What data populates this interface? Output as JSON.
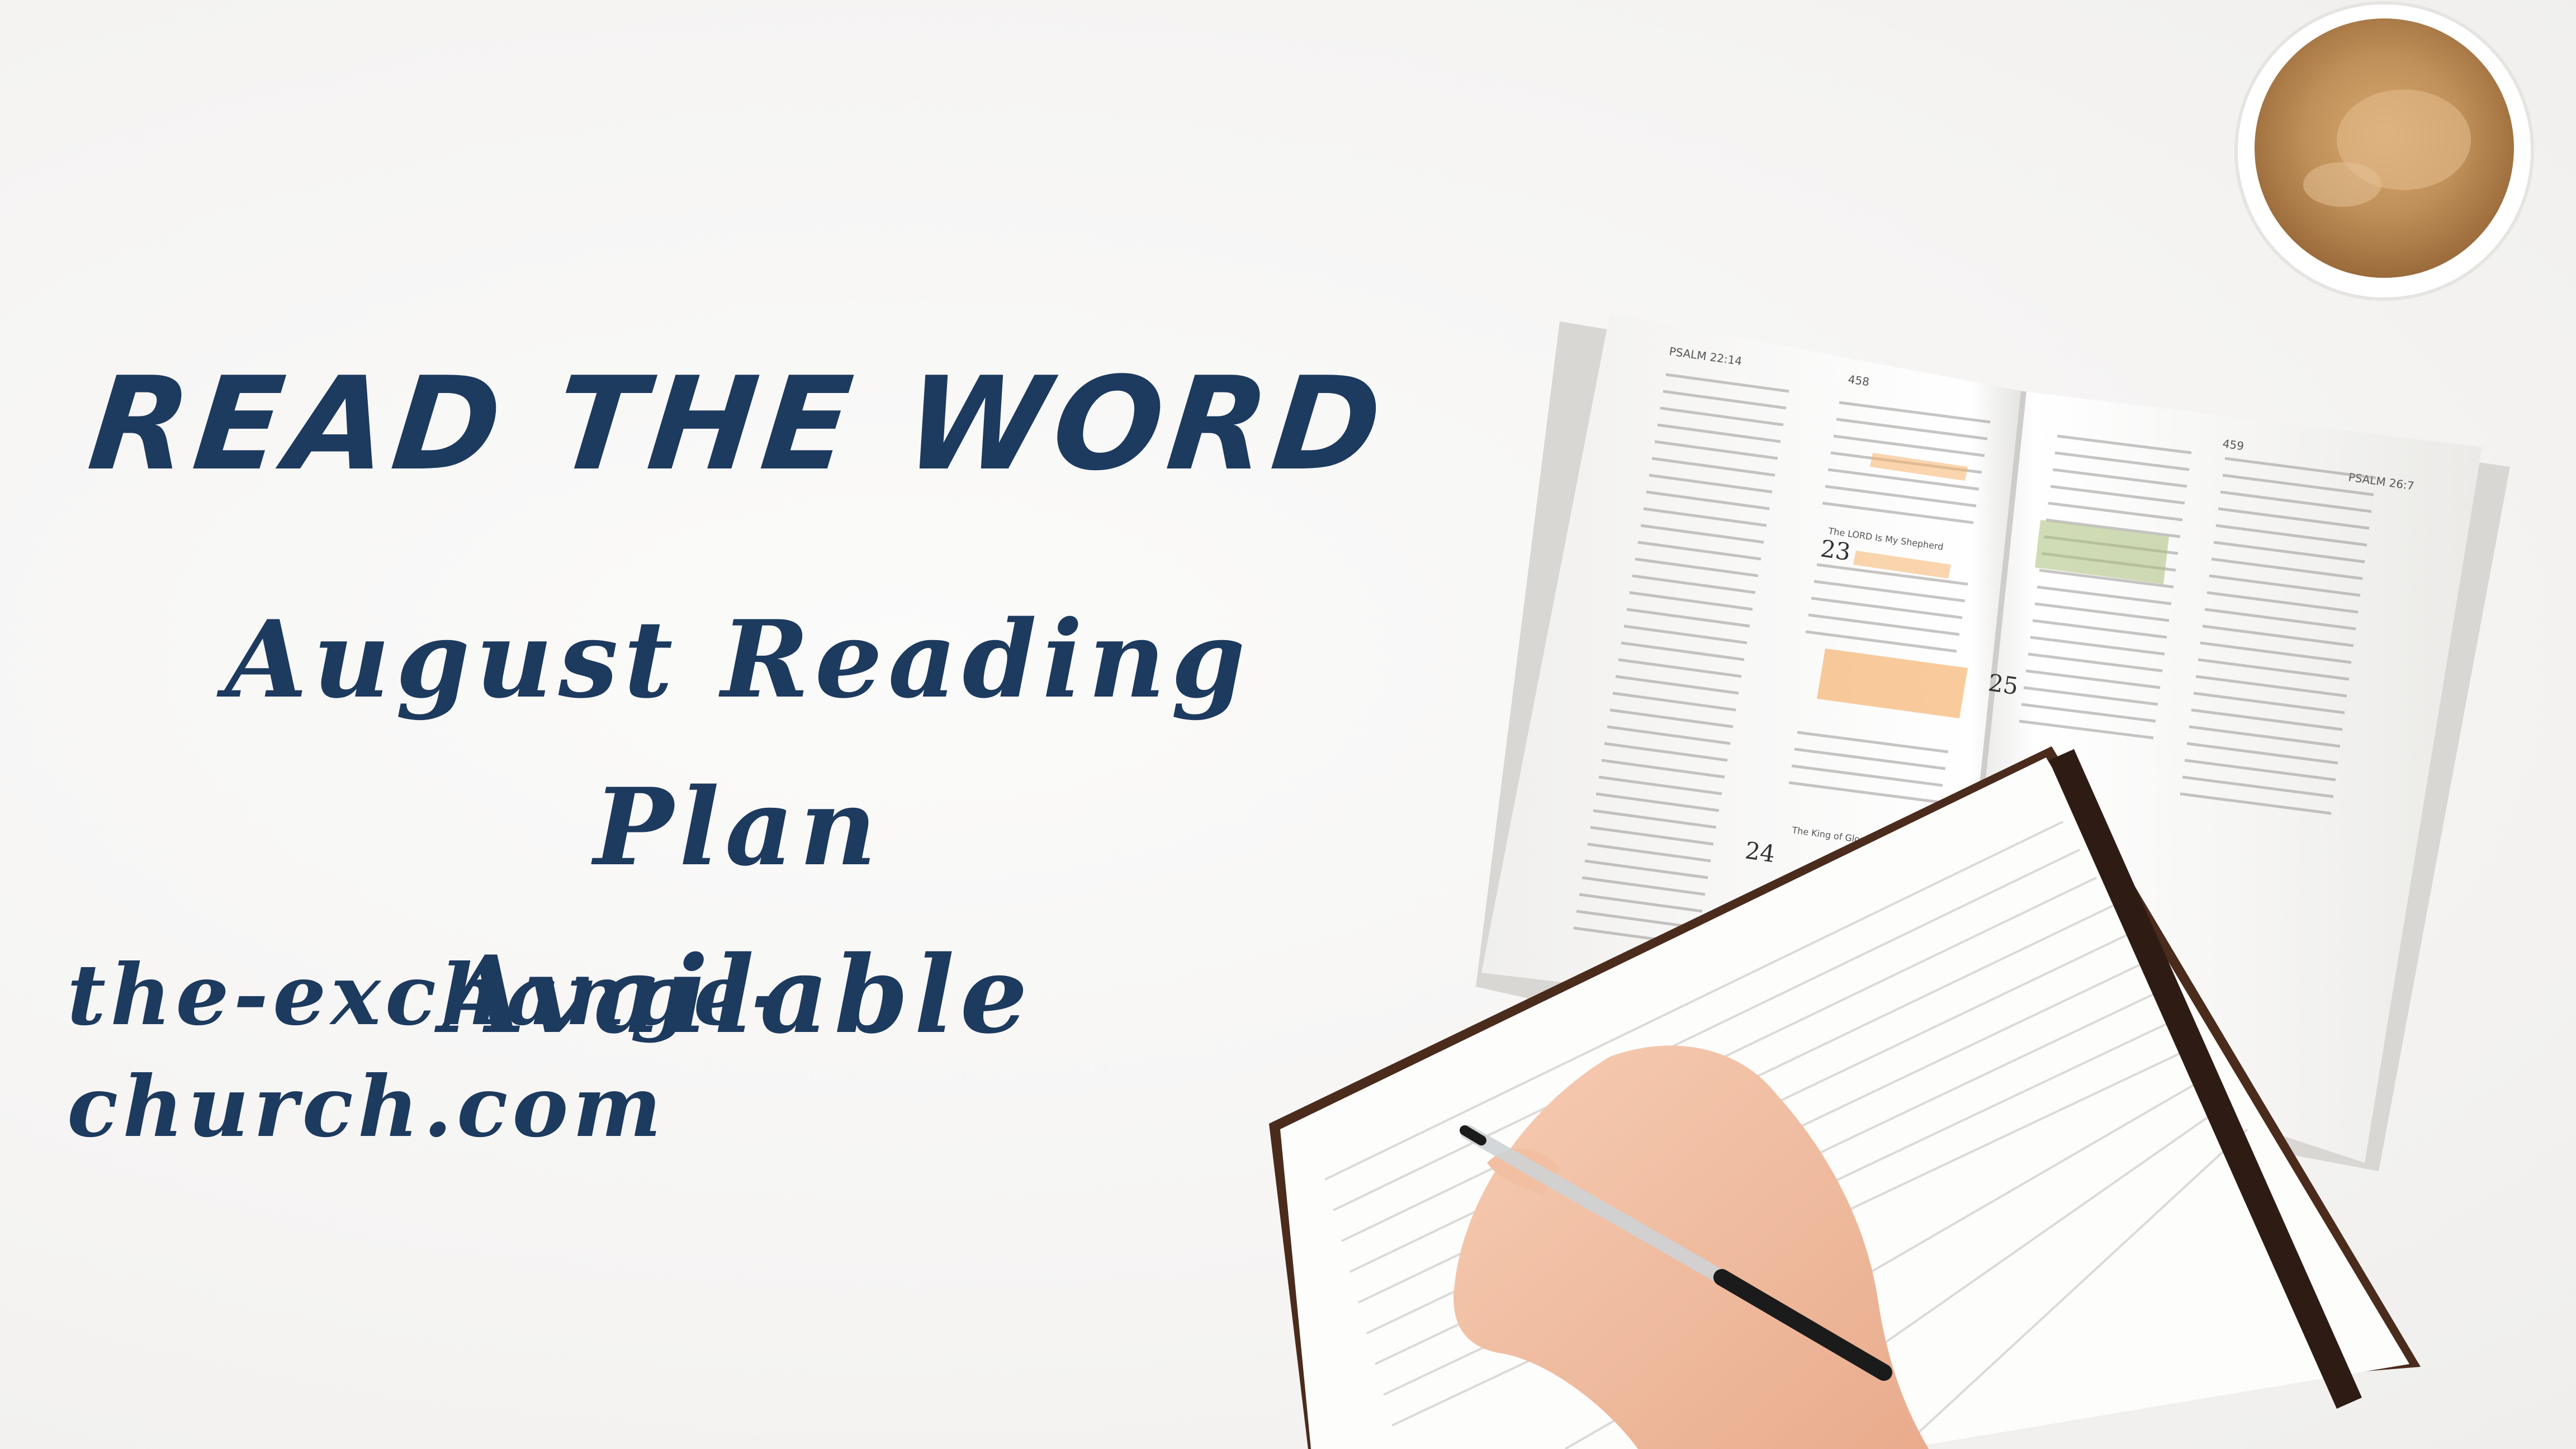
{
  "headline": "READ THE WORD",
  "subhead_line1": "August Reading Plan",
  "subhead_line2": "Available",
  "url": "the-exchange-church.com",
  "colors": {
    "text": "#1d3a5f",
    "background": "#f7f6f5",
    "coffee": "#b9884f",
    "notebook_cover": "#4a2b1c",
    "highlight_orange": "#f4a04a",
    "highlight_green": "#a9c07a"
  },
  "bible": {
    "left_header": "PSALM 22:14",
    "left_page_number": "458",
    "right_page_number": "459",
    "right_header": "PSALM 26:7",
    "chapter_23_heading": "The LORD Is My Shepherd",
    "chapter_23_number": "23",
    "chapter_24_heading": "The King of Glory",
    "chapter_24_number": "24",
    "chapter_25_number": "25"
  }
}
